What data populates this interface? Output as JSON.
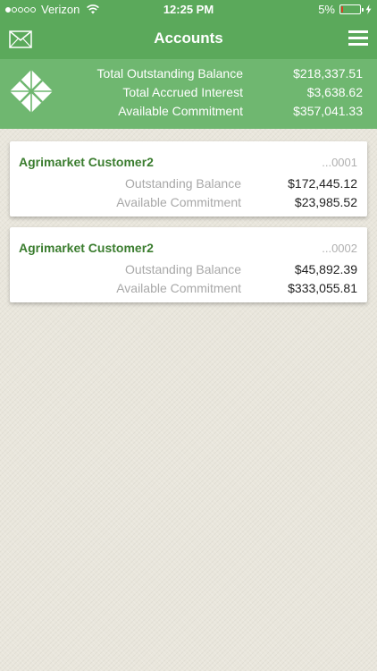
{
  "status_bar": {
    "carrier": "Verizon",
    "time": "12:25 PM",
    "battery_percent": "5%",
    "battery_level": 0.05,
    "battery_color": "#e03b24",
    "signal_bars_filled": 1,
    "signal_bars_total": 5
  },
  "nav": {
    "title": "Accounts",
    "left_icon": "mail-icon",
    "right_icon": "menu-icon"
  },
  "summary": {
    "logo": "leaf-logo-icon",
    "rows": [
      {
        "label": "Total Outstanding Balance",
        "value": "$218,337.51"
      },
      {
        "label": "Total Accrued Interest",
        "value": "$3,638.62"
      },
      {
        "label": "Available Commitment",
        "value": "$357,041.33"
      }
    ]
  },
  "accounts": [
    {
      "name": "Agrimarket Customer2",
      "number": "...0001",
      "rows": [
        {
          "label": "Outstanding Balance",
          "value": "$172,445.12"
        },
        {
          "label": "Available Commitment",
          "value": "$23,985.52"
        }
      ]
    },
    {
      "name": "Agrimarket Customer2",
      "number": "...0002",
      "rows": [
        {
          "label": "Outstanding Balance",
          "value": "$45,892.39"
        },
        {
          "label": "Available Commitment",
          "value": "$333,055.81"
        }
      ]
    }
  ],
  "colors": {
    "header_green": "#5ba95b",
    "banner_green": "#6fb770",
    "account_name_green": "#3b7d2f",
    "background": "#e9e6dc"
  }
}
